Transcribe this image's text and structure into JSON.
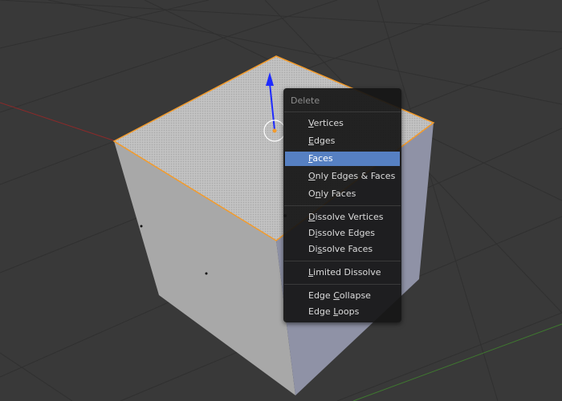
{
  "viewport": {
    "background": "#393939",
    "grid_line_color": "#303030",
    "x_axis_color": "#8a2a2a",
    "y_axis_color": "#3f7a2f",
    "cube_top_color": "#bdbdbd",
    "cube_left_color": "#a8a8a8",
    "cube_right_color": "#8f92a6",
    "selection_color": "#f39b2b",
    "manipulator_color": "#1f2bff"
  },
  "menu": {
    "title": "Delete",
    "items": [
      {
        "label": "Vertices",
        "mnemonic": "V",
        "mnem_index": 0,
        "active": false
      },
      {
        "label": "Edges",
        "mnemonic": "E",
        "mnem_index": 0,
        "active": false
      },
      {
        "label": "Faces",
        "mnemonic": "F",
        "mnem_index": 0,
        "active": true
      },
      {
        "label": "Only Edges & Faces",
        "mnemonic": "O",
        "mnem_index": 0,
        "active": false
      },
      {
        "label": "Only Faces",
        "mnemonic": "n",
        "mnem_index": 1,
        "active": false
      },
      {
        "label": "Dissolve Vertices",
        "mnemonic": "D",
        "mnem_index": 0,
        "active": false
      },
      {
        "label": "Dissolve Edges",
        "mnemonic": "i",
        "mnem_index": 1,
        "active": false
      },
      {
        "label": "Dissolve Faces",
        "mnemonic": "s",
        "mnem_index": 2,
        "active": false
      },
      {
        "label": "Limited Dissolve",
        "mnemonic": "L",
        "mnem_index": 0,
        "active": false
      },
      {
        "label": "Edge Collapse",
        "mnemonic": "C",
        "mnem_index": 5,
        "active": false
      },
      {
        "label": "Edge Loops",
        "mnemonic": "L",
        "mnem_index": 5,
        "active": false
      }
    ],
    "active_color": "#5680c2"
  }
}
